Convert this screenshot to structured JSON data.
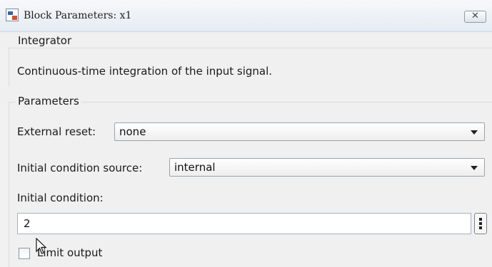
{
  "window": {
    "title": "Block Parameters: x1",
    "close_icon": "close-icon",
    "app_icon": "simulink-block-icon"
  },
  "block": {
    "group_label": "Integrator",
    "description": "Continuous-time integration of the input signal."
  },
  "parameters": {
    "group_label": "Parameters",
    "external_reset": {
      "label": "External reset:",
      "value": "none"
    },
    "initial_condition_source": {
      "label": "Initial condition source:",
      "value": "internal"
    },
    "initial_condition": {
      "label": "Initial condition:",
      "value": "2",
      "more_icon": "more-options-icon"
    },
    "limit_output": {
      "label": "Limit output",
      "checked": false
    }
  }
}
